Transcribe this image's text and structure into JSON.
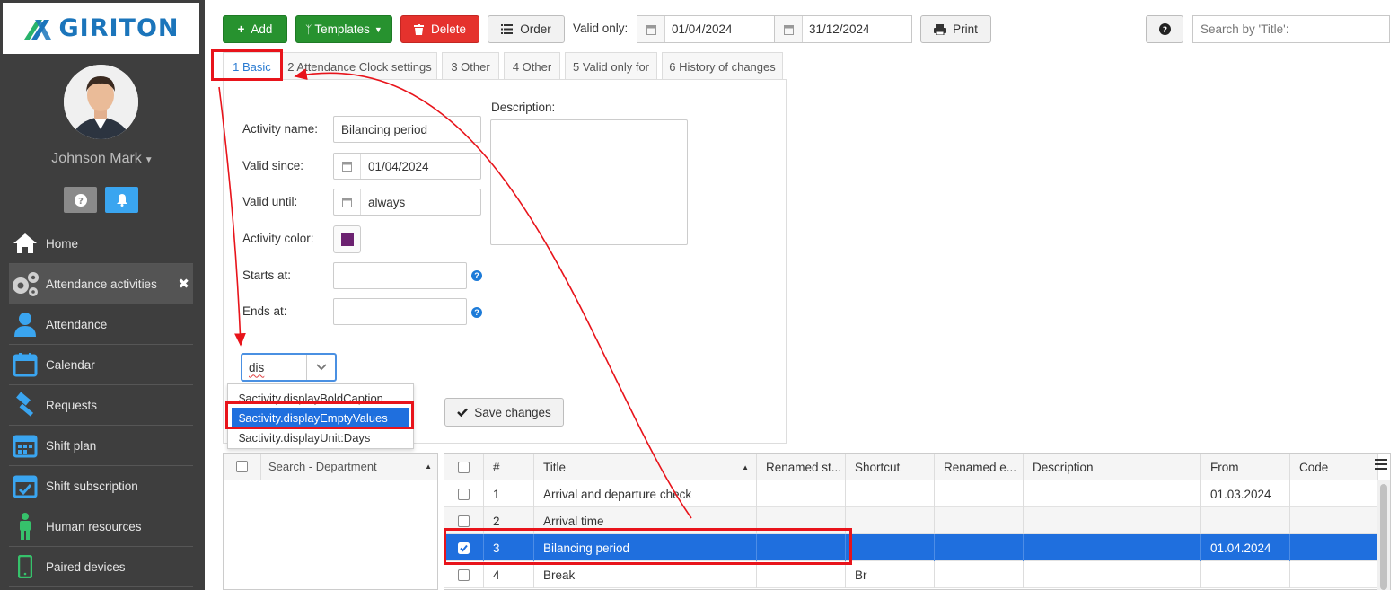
{
  "brand": {
    "name": "GIRITON",
    "color": "#1b75bb"
  },
  "user": {
    "name": "Johnson Mark"
  },
  "sidebar": {
    "items": [
      {
        "label": "Home",
        "icon": "home-icon"
      },
      {
        "label": "Attendance activities",
        "icon": "gears-icon"
      },
      {
        "label": "Attendance",
        "icon": "person-icon"
      },
      {
        "label": "Calendar",
        "icon": "calendar-icon"
      },
      {
        "label": "Requests",
        "icon": "gavel-icon"
      },
      {
        "label": "Shift plan",
        "icon": "calendar-grid-icon"
      },
      {
        "label": "Shift subscription",
        "icon": "calendar-check-icon"
      },
      {
        "label": "Human resources",
        "icon": "human-icon"
      },
      {
        "label": "Paired devices",
        "icon": "phone-icon"
      }
    ]
  },
  "toolbar": {
    "add": "Add",
    "templates": "Templates",
    "delete": "Delete",
    "order": "Order",
    "valid_only_label": "Valid only:",
    "valid_from": "01/04/2024",
    "valid_to": "31/12/2024",
    "print": "Print",
    "search_placeholder": "Search by 'Title':"
  },
  "tabs": [
    "1 Basic",
    "2 Attendance Clock settings",
    "3 Other",
    "4 Other",
    "5 Valid only for",
    "6 History of changes"
  ],
  "form": {
    "activity_name_label": "Activity name:",
    "activity_name": "Bilancing period",
    "valid_since_label": "Valid since:",
    "valid_since": "01/04/2024",
    "valid_until_label": "Valid until:",
    "valid_until": "always",
    "activity_color_label": "Activity color:",
    "activity_color": "#6b2170",
    "starts_at_label": "Starts at:",
    "ends_at_label": "Ends at:",
    "description_label": "Description:",
    "combo_value": "dis",
    "save": "Save changes"
  },
  "dropdown": {
    "options": [
      "$activity.displayBoldCaption",
      "$activity.displayEmptyValues",
      "$activity.displayUnit:Days"
    ],
    "selected_index": 1
  },
  "dept": {
    "search_placeholder": "Search - Department"
  },
  "grid": {
    "columns": [
      "#",
      "Title",
      "Renamed st...",
      "Shortcut",
      "Renamed e...",
      "Description",
      "From",
      "Code"
    ],
    "rows": [
      {
        "num": "1",
        "title": "Arrival and departure check",
        "shortcut": "",
        "from": "01.03.2024",
        "checked": false
      },
      {
        "num": "2",
        "title": "Arrival time",
        "shortcut": "",
        "from": "",
        "checked": false
      },
      {
        "num": "3",
        "title": "Bilancing period",
        "shortcut": "",
        "from": "01.04.2024",
        "checked": true
      },
      {
        "num": "4",
        "title": "Break",
        "shortcut": "Br",
        "from": "",
        "checked": false
      }
    ]
  },
  "annotation_color": "#e8141b"
}
